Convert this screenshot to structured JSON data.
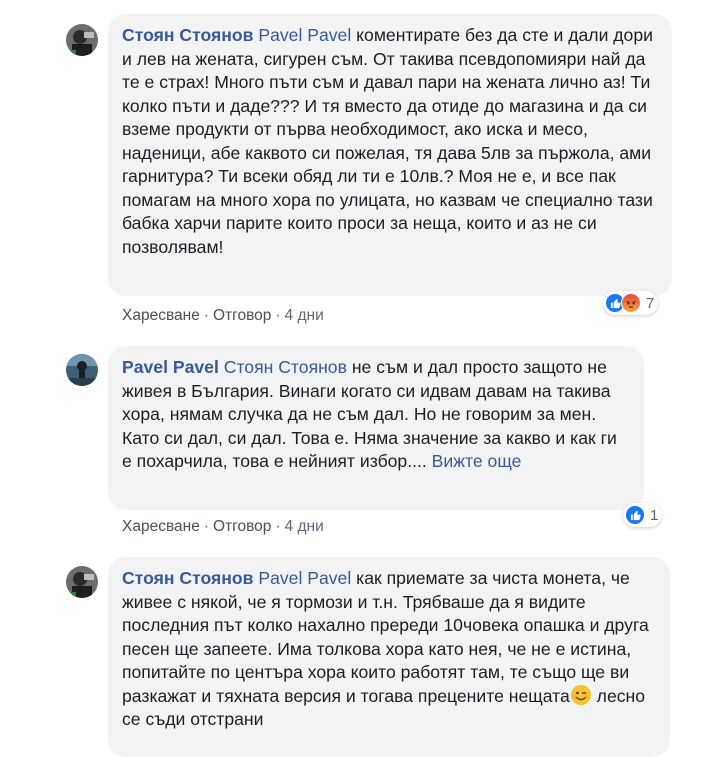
{
  "comments": [
    {
      "author": "Стоян Стоянов",
      "mention": "Pavel Pavel",
      "text": "коментирате без да сте и дали дори и лев на жената, сигурен съм. От такива псевдопомияри най да те е страх! Много пъти съм и давал пари на жената лично аз! Ти колко пъти и даде??? И тя вместо да отиде до магазина и да си вземе продукти от първа необходимост, ако иска и месо, наденици, абе каквото си пожелая, тя дава 5лв за пържола, ами гарнитура? Ти всеки обяд ли ти е 10лв.? Моя не е, и все пак помагам на много хора по улицата, но казвам че специално тази бабка харчи парите които проси за неща, които и аз не си позволявам!",
      "like": "Харесване",
      "reply": "Отговор",
      "time": "4 дни",
      "reaction_count": "7",
      "reactions": [
        "like-icon",
        "angry-icon"
      ]
    },
    {
      "author": "Pavel Pavel",
      "mention": "Стоян Стоянов",
      "text": "не съм и дал просто защото не живея в България. Винаги когато си идвам давам на такива хора, нямам случка да не съм дал. Но не говорим за мен. Като си дал, си дал. Това е. Няма значение за какво и как ги е похарчила, това е нейният избор....",
      "see_more": "Вижте още",
      "like": "Харесване",
      "reply": "Отговор",
      "time": "4 дни",
      "reaction_count": "1",
      "reactions": [
        "like-icon"
      ]
    },
    {
      "author": "Стоян Стоянов",
      "mention": "Pavel Pavel",
      "text": "как приемате за чиста монета, че живее с някой, че я тормози и т.н. Трябваше да я видите последния път колко нахално пререди 10човека опашка и друга песен ще запеете. Има толкова хора като нея, че не е истина, попитайте по центъра хора които работят там, те също ще ви разкажат и тяхната версия и тогава прецените нещата",
      "emoji": "wink-emoji",
      "text_after": "лесно се съди отстрани"
    }
  ],
  "colors": {
    "author": "#385898",
    "bubble": "#f2f3f5",
    "like_blue": "#1877f2"
  }
}
